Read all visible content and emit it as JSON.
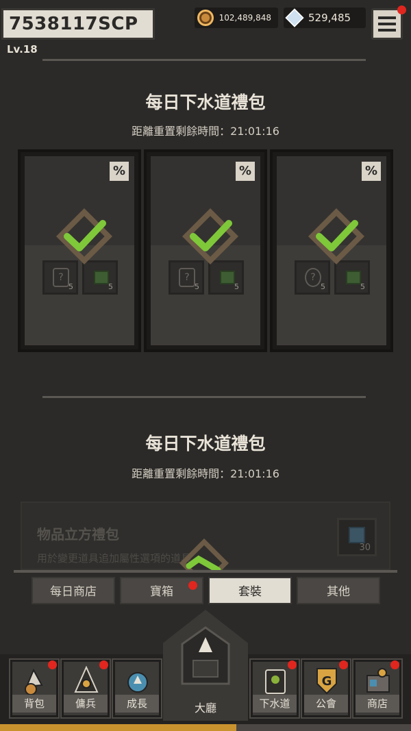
{
  "player": {
    "name": "7538117SCP",
    "level_label": "Lv.18"
  },
  "currencies": {
    "coins": "102,489,848",
    "gems": "529,485"
  },
  "daily_section_1": {
    "title": "每日下水道禮包",
    "timer": "距離重置剩餘時間：21:01:16",
    "packs": [
      {
        "tag": "%",
        "items": [
          {
            "icon": "mystery-scroll-icon",
            "count": "5"
          },
          {
            "icon": "green-cube-icon",
            "count": "5"
          }
        ],
        "claimed": true
      },
      {
        "tag": "%",
        "items": [
          {
            "icon": "mystery-tablet-icon",
            "count": "5"
          },
          {
            "icon": "green-cube-icon",
            "count": "5"
          }
        ],
        "claimed": true
      },
      {
        "tag": "%",
        "items": [
          {
            "icon": "mystery-orb-icon",
            "count": "5"
          },
          {
            "icon": "green-cube-icon",
            "count": "5"
          }
        ],
        "claimed": true
      }
    ]
  },
  "daily_section_2": {
    "title": "每日下水道禮包",
    "timer": "距離重置剩餘時間：21:01:16",
    "cube_pack": {
      "title": "物品立方禮包",
      "desc": "用於變更道具追加屬性選項的道具",
      "count": "30"
    }
  },
  "shop_tabs": [
    {
      "label": "每日商店",
      "active": false,
      "badge": false
    },
    {
      "label": "寶箱",
      "active": false,
      "badge": true
    },
    {
      "label": "套裝",
      "active": true,
      "badge": false
    },
    {
      "label": "其他",
      "active": false,
      "badge": false
    }
  ],
  "bottom_nav": [
    {
      "label": "背包",
      "icon": "backpack-icon",
      "badge": true
    },
    {
      "label": "傭兵",
      "icon": "mercenary-icon",
      "badge": true
    },
    {
      "label": "成長",
      "icon": "growth-icon",
      "badge": false
    },
    {
      "label": "大廳",
      "icon": "hall-icon",
      "badge": false
    },
    {
      "label": "下水道",
      "icon": "sewer-icon",
      "badge": true
    },
    {
      "label": "公會",
      "icon": "guild-icon",
      "badge": true
    },
    {
      "label": "商店",
      "icon": "shop-icon",
      "badge": true
    }
  ],
  "exp_progress": 0.575,
  "colors": {
    "check": "#7ec83a",
    "badge": "#e0261e",
    "exp": "#c8922f"
  }
}
